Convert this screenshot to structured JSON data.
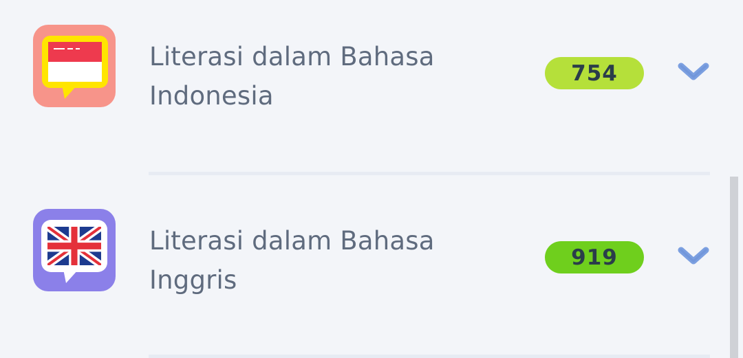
{
  "items": [
    {
      "title_line1": "Literasi dalam Bahasa",
      "title_line2": "Indonesia",
      "score": "754",
      "icon": "indonesian-flag-speech-bubble-icon",
      "badge_color": "#b5e03a"
    },
    {
      "title_line1": "Literasi dalam Bahasa",
      "title_line2": "Inggris",
      "score": "919",
      "icon": "uk-flag-speech-bubble-icon",
      "badge_color": "#6fcf1d"
    }
  ],
  "colors": {
    "background": "#f3f5f9",
    "text": "#5f6b7e",
    "chevron": "#6d93d6",
    "divider": "#e7ebf3"
  }
}
